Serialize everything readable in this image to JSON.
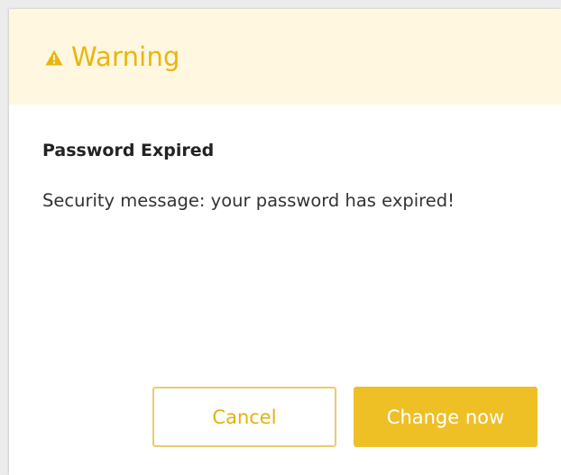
{
  "dialog": {
    "header": {
      "icon": "warning-triangle-icon",
      "title": "Warning"
    },
    "subtitle": "Password Expired",
    "message": "Security message: your password has expired!",
    "buttons": {
      "cancel_label": "Cancel",
      "primary_label": "Change now"
    }
  },
  "colors": {
    "accent": "#eec026",
    "header_bg": "#fff7e0",
    "title_text": "#e9b60e",
    "cancel_border": "#eccb6c"
  }
}
